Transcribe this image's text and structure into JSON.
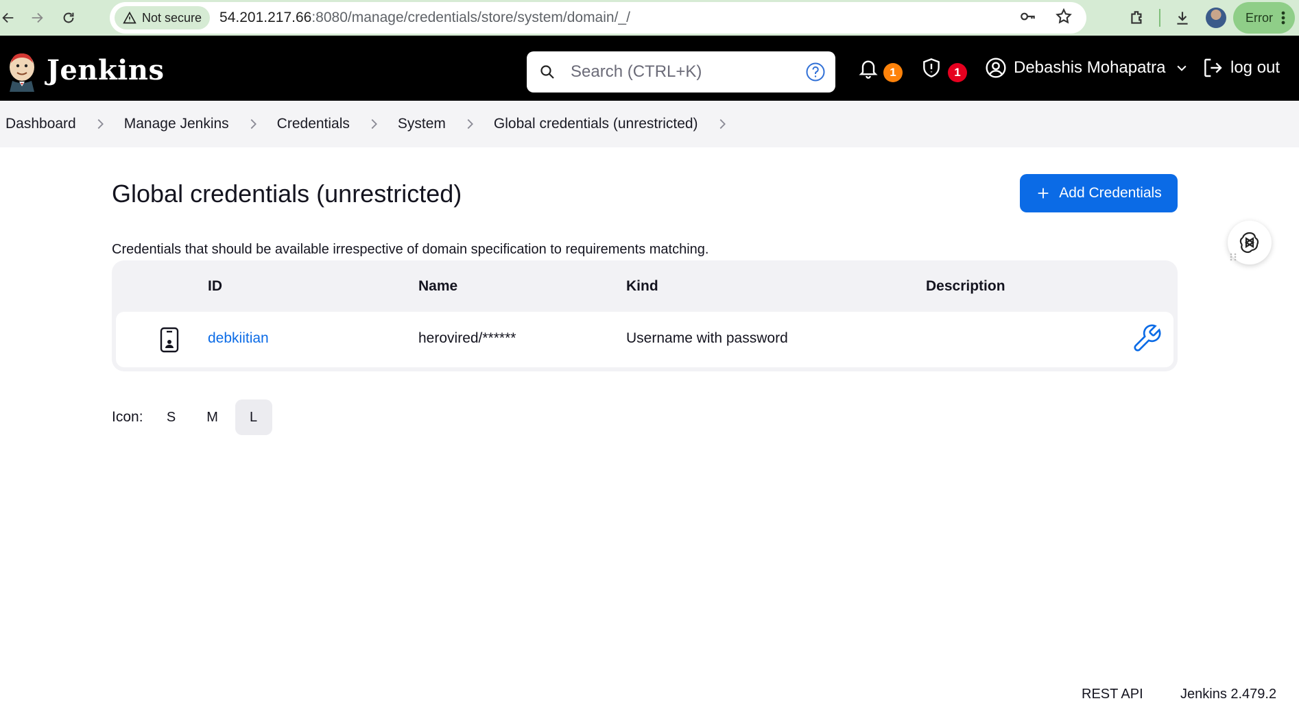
{
  "browser": {
    "security_label": "Not secure",
    "url_host": "54.201.217.66",
    "url_rest": ":8080/manage/credentials/store/system/domain/_/",
    "error_label": "Error"
  },
  "header": {
    "brand": "Jenkins",
    "search_placeholder": "Search (CTRL+K)",
    "notifications_count": "1",
    "security_count": "1",
    "user_name": "Debashis Mohapatra",
    "logout_label": "log out"
  },
  "breadcrumbs": [
    "Dashboard",
    "Manage Jenkins",
    "Credentials",
    "System",
    "Global credentials (unrestricted)"
  ],
  "main": {
    "title": "Global credentials (unrestricted)",
    "add_button_label": "Add Credentials",
    "description": "Credentials that should be available irrespective of domain specification to requirements matching."
  },
  "table": {
    "headers": {
      "id": "ID",
      "name": "Name",
      "kind": "Kind",
      "description": "Description"
    },
    "rows": [
      {
        "id": "debkiitian",
        "name": "herovired/******",
        "kind": "Username with password",
        "description": "",
        "icon": "user-credential-icon"
      }
    ]
  },
  "icon_size": {
    "label": "Icon:",
    "options": [
      "S",
      "M",
      "L"
    ],
    "selected": "L"
  },
  "footer": {
    "rest_api": "REST API",
    "version": "Jenkins 2.479.2"
  },
  "colors": {
    "accent": "#0b6be6",
    "header_bg": "#000000",
    "badge_orange": "#fe820a",
    "badge_red": "#e6001f",
    "browser_bar": "#d6ebd4"
  }
}
